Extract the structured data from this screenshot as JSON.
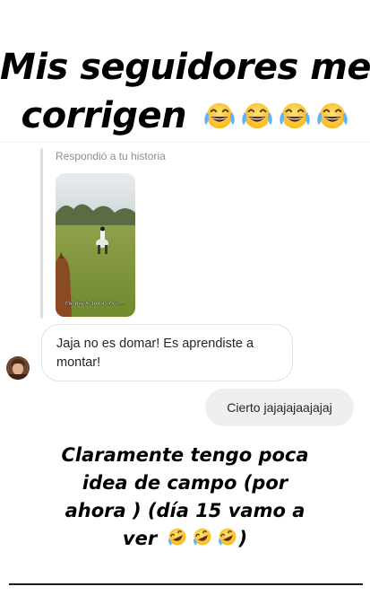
{
  "header": {
    "title_line1": "Mis seguidores me",
    "title_line2": "corrigen"
  },
  "message": {
    "reply_label": "Respondió a tu historia",
    "story_caption": "Me duele todo el cu....",
    "incoming_text": "Jaja no es domar! Es aprendiste a montar!",
    "outgoing_text": "Cierto jajajajaajajaj"
  },
  "footer": {
    "line1": "Claramente tengo poca",
    "line2": "idea de campo (por",
    "line3": "ahora ) (día 15 vamo a",
    "line4": "ver"
  },
  "icons": {
    "header_emoji": "face-with-tears-of-joy-icon",
    "footer_emoji": "rolling-on-floor-laughing-icon"
  }
}
